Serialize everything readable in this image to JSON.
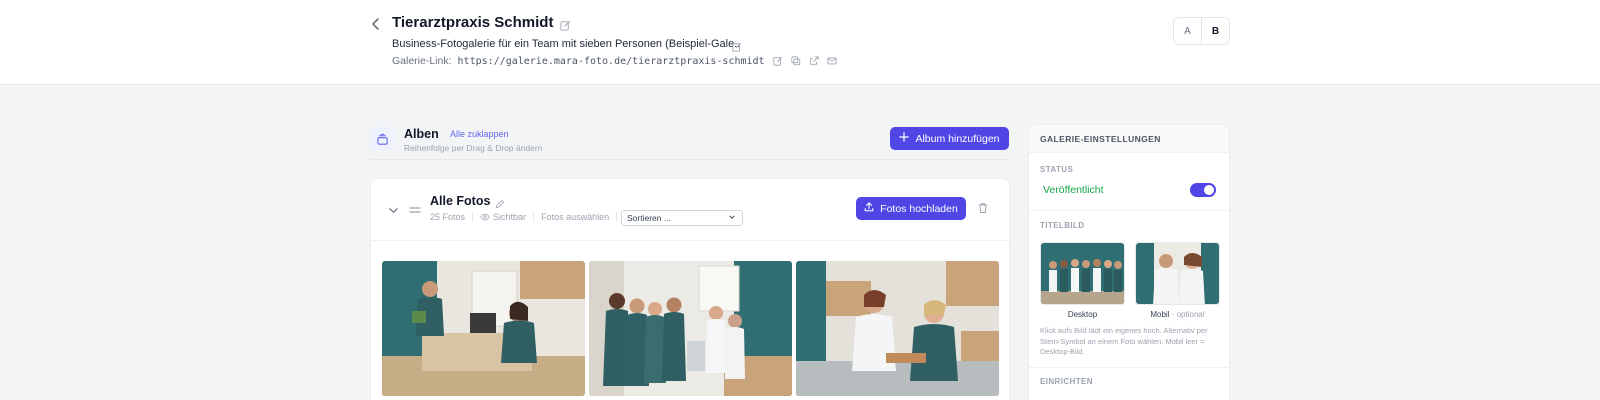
{
  "header": {
    "title": "Tierarztpraxis Schmidt",
    "subtitle": "Business-Fotogalerie für ein Team mit sieben Personen (Beispiel-Gale..",
    "link_label": "Galerie-Link:",
    "link_url": "https://galerie.mara-foto.de/tierarztpraxis-schmidt",
    "ab_toggle": {
      "a": "A",
      "b": "B",
      "active": "B"
    }
  },
  "albums": {
    "title": "Alben",
    "collapse_all": "Alle zuklappen",
    "hint": "Reihenfolge per Drag & Drop ändern",
    "add_button": "Album hinzufügen"
  },
  "album": {
    "name": "Alle Fotos",
    "count": "25 Fotos",
    "visibility": "Sichtbar",
    "select_photos": "Fotos auswählen",
    "sort_placeholder": "Sortieren ...",
    "upload_button": "Fotos hochladen"
  },
  "settings": {
    "heading": "GALERIE-EINSTELLUNGEN",
    "status_label": "STATUS",
    "status_value": "Veröffentlicht",
    "published": true,
    "cover_label": "TITELBILD",
    "desktop_caption": "Desktop",
    "mobile_caption": "Mobil",
    "mobile_optional": "· optional",
    "cover_hint": "Klick aufs Bild lädt ein eigenes hoch. Alternativ per Stern-Symbol an einem Foto wählen. Mobil leer = Desktop-Bild.",
    "setup_label": "EINRICHTEN"
  },
  "colors": {
    "accent": "#4f46e5",
    "published": "#16a34a",
    "scrub_teal": "#2f6e72"
  }
}
